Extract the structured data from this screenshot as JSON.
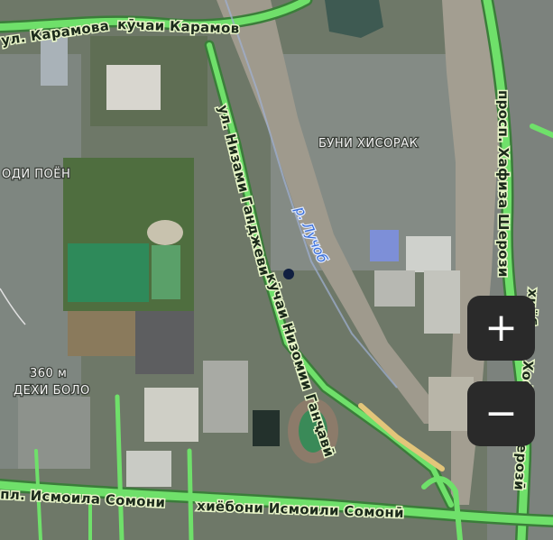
{
  "map": {
    "roads": {
      "karamova_1": "ул. Карамова",
      "karamova_2": "кӯчаи Карамов",
      "nizami_ru": "ул. Низами Ганджеви",
      "nizami_tj": "кӯчаи Низомии Ганҷавӣ",
      "hafiz_ru": "просп. Хафиза Шерози",
      "hafiz_tj": "хиёбони Хофизи Шерозӣ",
      "somoni_ru": "пл. Исмоила Сомони",
      "somoni_tj": "хиёбони Исмоили Сомонӣ"
    },
    "water": {
      "river": "р. Лучоб"
    },
    "areas": {
      "buni_hisorak": "БУНИ ХИСОРАК",
      "poen": "ОДИ ПОЁН",
      "dehi_bolo": "ДЕХИ БОЛО"
    },
    "elevation": "360 м"
  },
  "controls": {
    "zoom_in": "+",
    "zoom_out": "−"
  }
}
